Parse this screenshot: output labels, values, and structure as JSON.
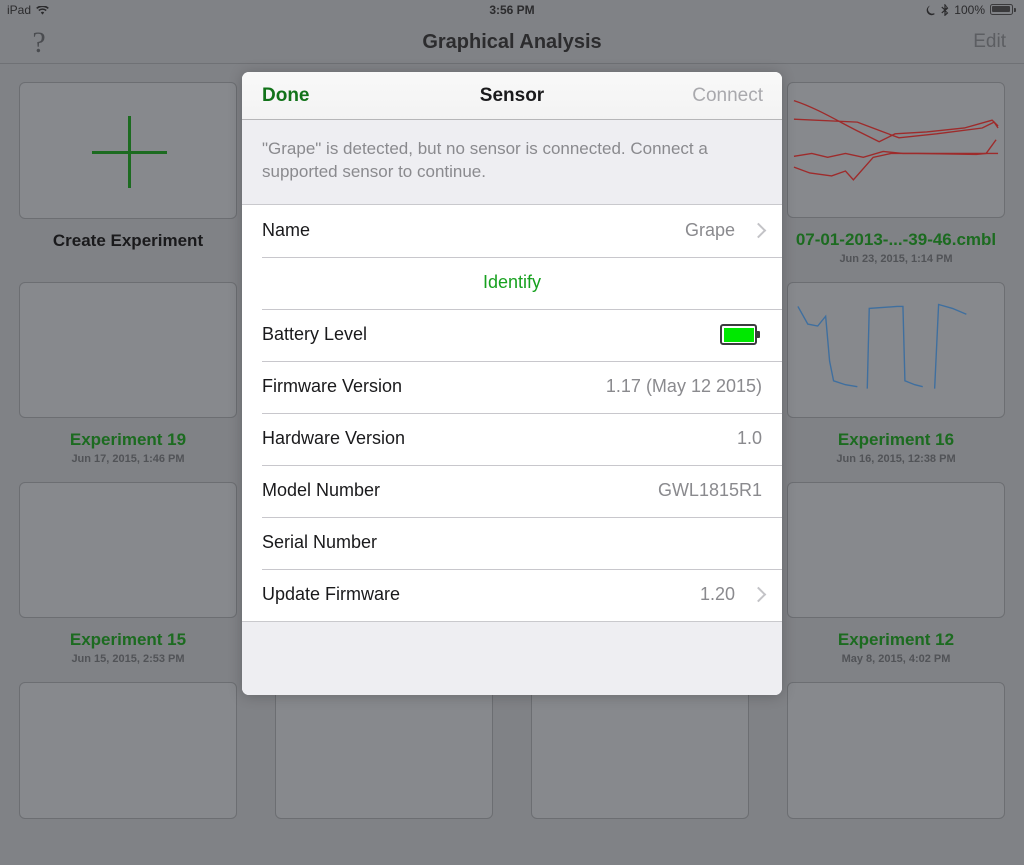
{
  "status_bar": {
    "device": "iPad",
    "wifi_icon": "wifi-icon",
    "time": "3:56 PM",
    "dnd_icon": "moon-icon",
    "bluetooth_icon": "bluetooth-icon",
    "battery_percent": "100%",
    "battery_icon": "battery-icon"
  },
  "nav_bar": {
    "help_icon": "question-mark-icon",
    "help_glyph": "?",
    "title": "Graphical Analysis",
    "edit_label": "Edit"
  },
  "modal": {
    "done_label": "Done",
    "title": "Sensor",
    "connect_label": "Connect",
    "notice": "\"Grape\" is detected, but no sensor is connected. Connect a supported sensor to continue.",
    "rows": [
      {
        "label": "Name",
        "value": "Grape",
        "chevron": true
      },
      {
        "label": "Identify",
        "action": true
      },
      {
        "label": "Battery Level",
        "battery": true,
        "battery_fill_color": "#00e800"
      },
      {
        "label": "Firmware Version",
        "value": "1.17  (May 12 2015)"
      },
      {
        "label": "Hardware Version",
        "value": "1.0"
      },
      {
        "label": "Model Number",
        "value": "GWL1815R1"
      },
      {
        "label": "Serial Number",
        "value": ""
      },
      {
        "label": "Update Firmware",
        "value": "1.20",
        "chevron": true
      }
    ]
  },
  "colors": {
    "accent_green": "#1c6b20",
    "action_green": "#17a11f",
    "backdrop": "#808286",
    "chart_red": "#9e2b2b",
    "chart_blue": "#3f6f9f"
  },
  "grid": {
    "items": [
      {
        "title": "Create Experiment",
        "date": "",
        "kind": "create",
        "title_color": "black"
      },
      {
        "title": "",
        "date": "",
        "kind": "empty"
      },
      {
        "title": "",
        "date": "",
        "kind": "empty"
      },
      {
        "title": "07-01-2013-...-39-46.cmbl",
        "date": "Jun 23, 2015, 1:14 PM",
        "kind": "chart-red"
      },
      {
        "title": "Experiment 19",
        "date": "Jun 17, 2015, 1:46 PM",
        "kind": "empty"
      },
      {
        "title": "",
        "date": "",
        "kind": "empty"
      },
      {
        "title": "",
        "date": "",
        "kind": "empty"
      },
      {
        "title": "Experiment 16",
        "date": "Jun 16, 2015, 12:38 PM",
        "kind": "chart-blue"
      },
      {
        "title": "Experiment 15",
        "date": "Jun 15, 2015, 2:53 PM",
        "kind": "empty"
      },
      {
        "title": "",
        "date": "",
        "kind": "empty"
      },
      {
        "title": "",
        "date": "",
        "kind": "empty"
      },
      {
        "title": "Experiment 12",
        "date": "May 8, 2015, 4:02 PM",
        "kind": "empty"
      },
      {
        "title": "",
        "date": "",
        "kind": "empty"
      },
      {
        "title": "",
        "date": "",
        "kind": "empty"
      },
      {
        "title": "",
        "date": "",
        "kind": "empty"
      },
      {
        "title": "",
        "date": "",
        "kind": "empty"
      }
    ]
  }
}
